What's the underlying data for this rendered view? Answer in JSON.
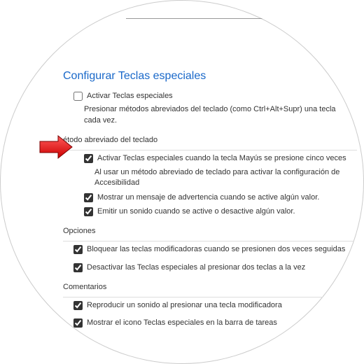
{
  "title": "Configurar Teclas especiales",
  "main_checkbox": {
    "label": "Activar Teclas especiales",
    "checked": false,
    "desc": "Presionar métodos abreviados del teclado (como Ctrl+Alt+Supr) una tecla cada vez."
  },
  "shortcut_group": {
    "heading": "étodo abreviado del teclado",
    "activate": {
      "label": "Activar Teclas especiales cuando la tecla Mayús se presione cinco veces",
      "checked": true
    },
    "desc": "Al usar un método abreviado de teclado para activar la configuración de Accesibilidad",
    "warn": {
      "label": "Mostrar un mensaje de advertencia cuando se active algún valor.",
      "checked": true
    },
    "sound": {
      "label": "Emitir un sonido cuando se active o desactive algún valor.",
      "checked": true
    }
  },
  "options_group": {
    "heading": "Opciones",
    "lock": {
      "label": "Bloquear las teclas modificadoras cuando se presionen dos veces seguidas",
      "checked": true
    },
    "disable": {
      "label": "Desactivar las Teclas especiales al presionar dos teclas a la vez",
      "checked": true
    }
  },
  "feedback_group": {
    "heading": "Comentarios",
    "play_sound": {
      "label": "Reproducir un sonido al presionar una tecla modificadora",
      "checked": true
    },
    "show_icon": {
      "label": "Mostrar el icono Teclas especiales en la barra de tareas",
      "checked": true
    }
  }
}
